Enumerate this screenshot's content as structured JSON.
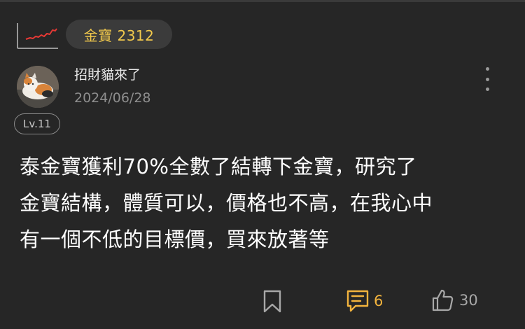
{
  "stock": {
    "label": "金寶 2312",
    "chip_color": "#f2c94c",
    "sparkline_color": "#e53935"
  },
  "author": {
    "name": "招財貓來了",
    "date": "2024/06/28",
    "level": "Lv.11"
  },
  "post": {
    "text": "泰金寶獲利70%全數了結轉下金寶，研究了\n金寶結構，體質可以，價格也不高，在我心中\n有一個不低的目標價，買來放著等"
  },
  "actions": {
    "bookmark_icon": "bookmark-icon",
    "comment_icon": "comment-icon",
    "comment_count": "6",
    "comment_color": "#f2b33d",
    "like_icon": "thumbs-up-icon",
    "like_count": "30"
  },
  "menu": {
    "icon": "more-vertical-icon"
  }
}
